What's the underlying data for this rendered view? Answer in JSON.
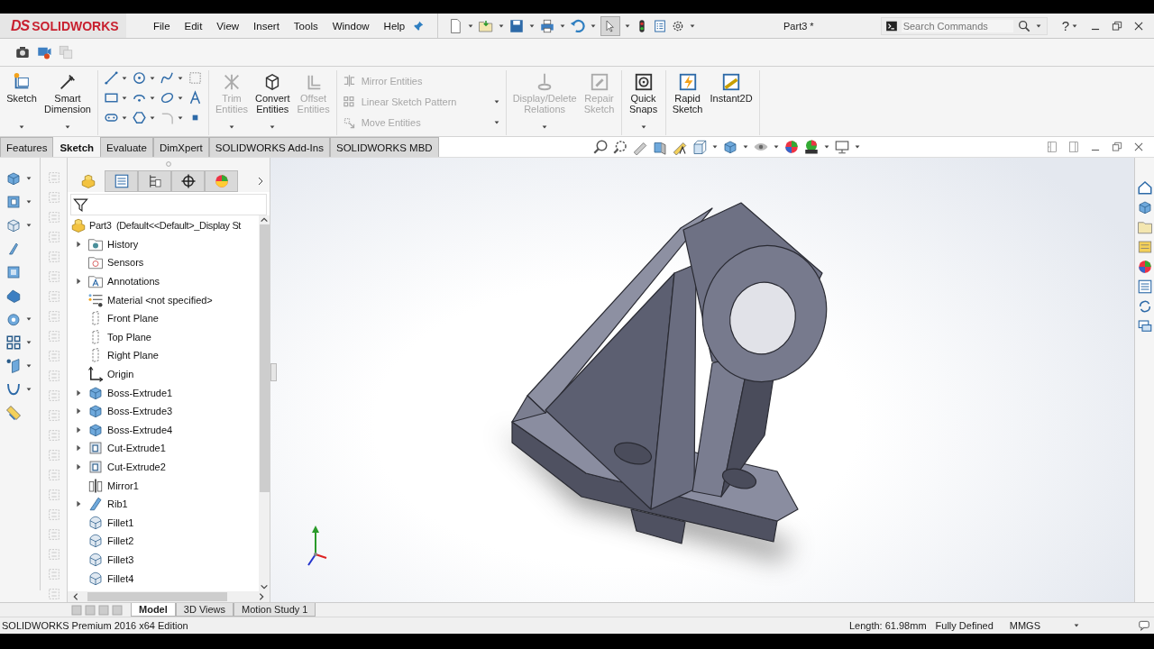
{
  "logo": {
    "mark": "DS",
    "name": "SOLIDWORKS"
  },
  "menu": [
    "File",
    "Edit",
    "View",
    "Insert",
    "Tools",
    "Window",
    "Help"
  ],
  "document_title": "Part3 *",
  "search": {
    "placeholder": "Search Commands"
  },
  "help": "?",
  "command_manager": {
    "groups": [
      {
        "buttons": [
          {
            "label": "Sketch",
            "kind": "sketch",
            "disabled": false,
            "dropdown": true
          },
          {
            "label": "Smart Dimension",
            "kind": "smart-dimension",
            "disabled": false,
            "dropdown": true
          }
        ]
      },
      {
        "buttons": [
          {
            "label": "Trim Entities",
            "kind": "trim",
            "disabled": true,
            "dropdown": true
          },
          {
            "label": "Convert Entities",
            "kind": "convert",
            "disabled": false,
            "dropdown": true
          },
          {
            "label": "Offset Entities",
            "kind": "offset",
            "disabled": true,
            "dropdown": false
          }
        ]
      },
      {
        "stacked_buttons": [
          {
            "label": "Mirror Entities",
            "kind": "mirror",
            "disabled": true,
            "dropdown": false
          },
          {
            "label": "Linear Sketch Pattern",
            "kind": "pattern",
            "disabled": true,
            "dropdown": true
          },
          {
            "label": "Move Entities",
            "kind": "move",
            "disabled": true,
            "dropdown": true
          }
        ]
      },
      {
        "buttons": [
          {
            "label": "Display/Delete Relations",
            "kind": "relations",
            "disabled": true,
            "dropdown": true
          },
          {
            "label": "Repair Sketch",
            "kind": "repair",
            "disabled": true,
            "dropdown": false
          }
        ]
      },
      {
        "buttons": [
          {
            "label": "Quick Snaps",
            "kind": "snaps",
            "disabled": false,
            "dropdown": true
          }
        ]
      },
      {
        "buttons": [
          {
            "label": "Rapid Sketch",
            "kind": "rapid",
            "disabled": false,
            "dropdown": false
          },
          {
            "label": "Instant2D",
            "kind": "instant2d",
            "disabled": false,
            "dropdown": false
          }
        ]
      }
    ]
  },
  "tabs": [
    {
      "label": "Features",
      "selected": false
    },
    {
      "label": "Sketch",
      "selected": true
    },
    {
      "label": "Evaluate",
      "selected": false
    },
    {
      "label": "DimXpert",
      "selected": false
    },
    {
      "label": "SOLIDWORKS Add-Ins",
      "selected": false
    },
    {
      "label": "SOLIDWORKS MBD",
      "selected": false
    }
  ],
  "panel_tabs": [
    {
      "kind": "feature-manager",
      "selected": true
    },
    {
      "kind": "property-manager",
      "selected": false
    },
    {
      "kind": "configuration-manager",
      "selected": false
    },
    {
      "kind": "dimxpert-manager",
      "selected": false
    },
    {
      "kind": "display-manager",
      "selected": false
    }
  ],
  "feature_tree": {
    "root": "Part3  (Default<<Default>_Display St",
    "items": [
      {
        "label": "History",
        "kind": "history",
        "expandable": true
      },
      {
        "label": "Sensors",
        "kind": "sensors",
        "expandable": false
      },
      {
        "label": "Annotations",
        "kind": "annotations",
        "expandable": true
      },
      {
        "label": "Material <not specified>",
        "kind": "material",
        "expandable": false
      },
      {
        "label": "Front Plane",
        "kind": "plane",
        "expandable": false
      },
      {
        "label": "Top Plane",
        "kind": "plane",
        "expandable": false
      },
      {
        "label": "Right Plane",
        "kind": "plane",
        "expandable": false
      },
      {
        "label": "Origin",
        "kind": "origin",
        "expandable": false
      },
      {
        "label": "Boss-Extrude1",
        "kind": "boss",
        "expandable": true
      },
      {
        "label": "Boss-Extrude3",
        "kind": "boss",
        "expandable": true
      },
      {
        "label": "Boss-Extrude4",
        "kind": "boss",
        "expandable": true
      },
      {
        "label": "Cut-Extrude1",
        "kind": "cut",
        "expandable": true
      },
      {
        "label": "Cut-Extrude2",
        "kind": "cut",
        "expandable": true
      },
      {
        "label": "Mirror1",
        "kind": "mirror",
        "expandable": false
      },
      {
        "label": "Rib1",
        "kind": "rib",
        "expandable": true
      },
      {
        "label": "Fillet1",
        "kind": "fillet",
        "expandable": false
      },
      {
        "label": "Fillet2",
        "kind": "fillet",
        "expandable": false
      },
      {
        "label": "Fillet3",
        "kind": "fillet",
        "expandable": false
      },
      {
        "label": "Fillet4",
        "kind": "fillet",
        "expandable": false
      }
    ]
  },
  "bottom_tabs": [
    {
      "label": "Model",
      "selected": true
    },
    {
      "label": "3D Views",
      "selected": false
    },
    {
      "label": "Motion Study 1",
      "selected": false
    }
  ],
  "status_bar": {
    "edition": "SOLIDWORKS Premium 2016 x64 Edition",
    "length": "Length: 61.98mm",
    "sketch_state": "Fully Defined",
    "units": "MMGS"
  }
}
